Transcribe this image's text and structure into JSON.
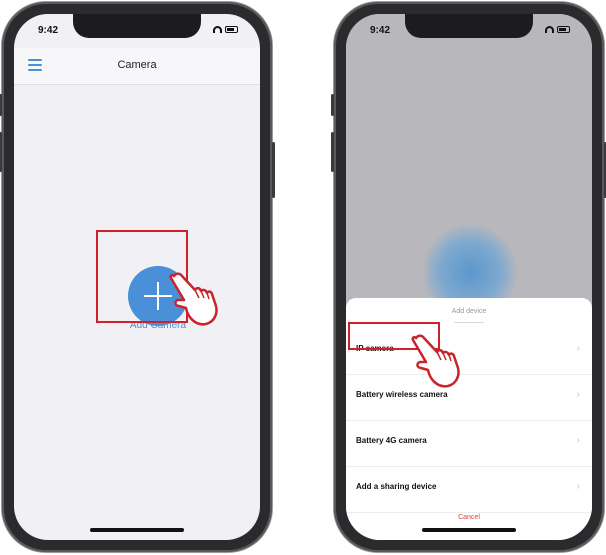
{
  "left_phone": {
    "status": {
      "time": "9:42"
    },
    "nav": {
      "title": "Camera"
    },
    "add_button_label": "Add Camera"
  },
  "right_phone": {
    "status": {
      "time": "9:42"
    },
    "sheet": {
      "title": "Add device",
      "items": [
        {
          "label": "IP camera"
        },
        {
          "label": "Battery wireless camera"
        },
        {
          "label": "Battery 4G camera"
        },
        {
          "label": "Add a sharing device"
        }
      ],
      "cancel_label": "Cancel"
    }
  },
  "colors": {
    "accent": "#4a90d9",
    "highlight": "#d0212b",
    "cancel": "#e0413b"
  },
  "icons": [
    "menu-icon",
    "plus-icon",
    "pointing-hand-icon",
    "chevron-right-icon",
    "wifi-icon",
    "battery-icon"
  ]
}
